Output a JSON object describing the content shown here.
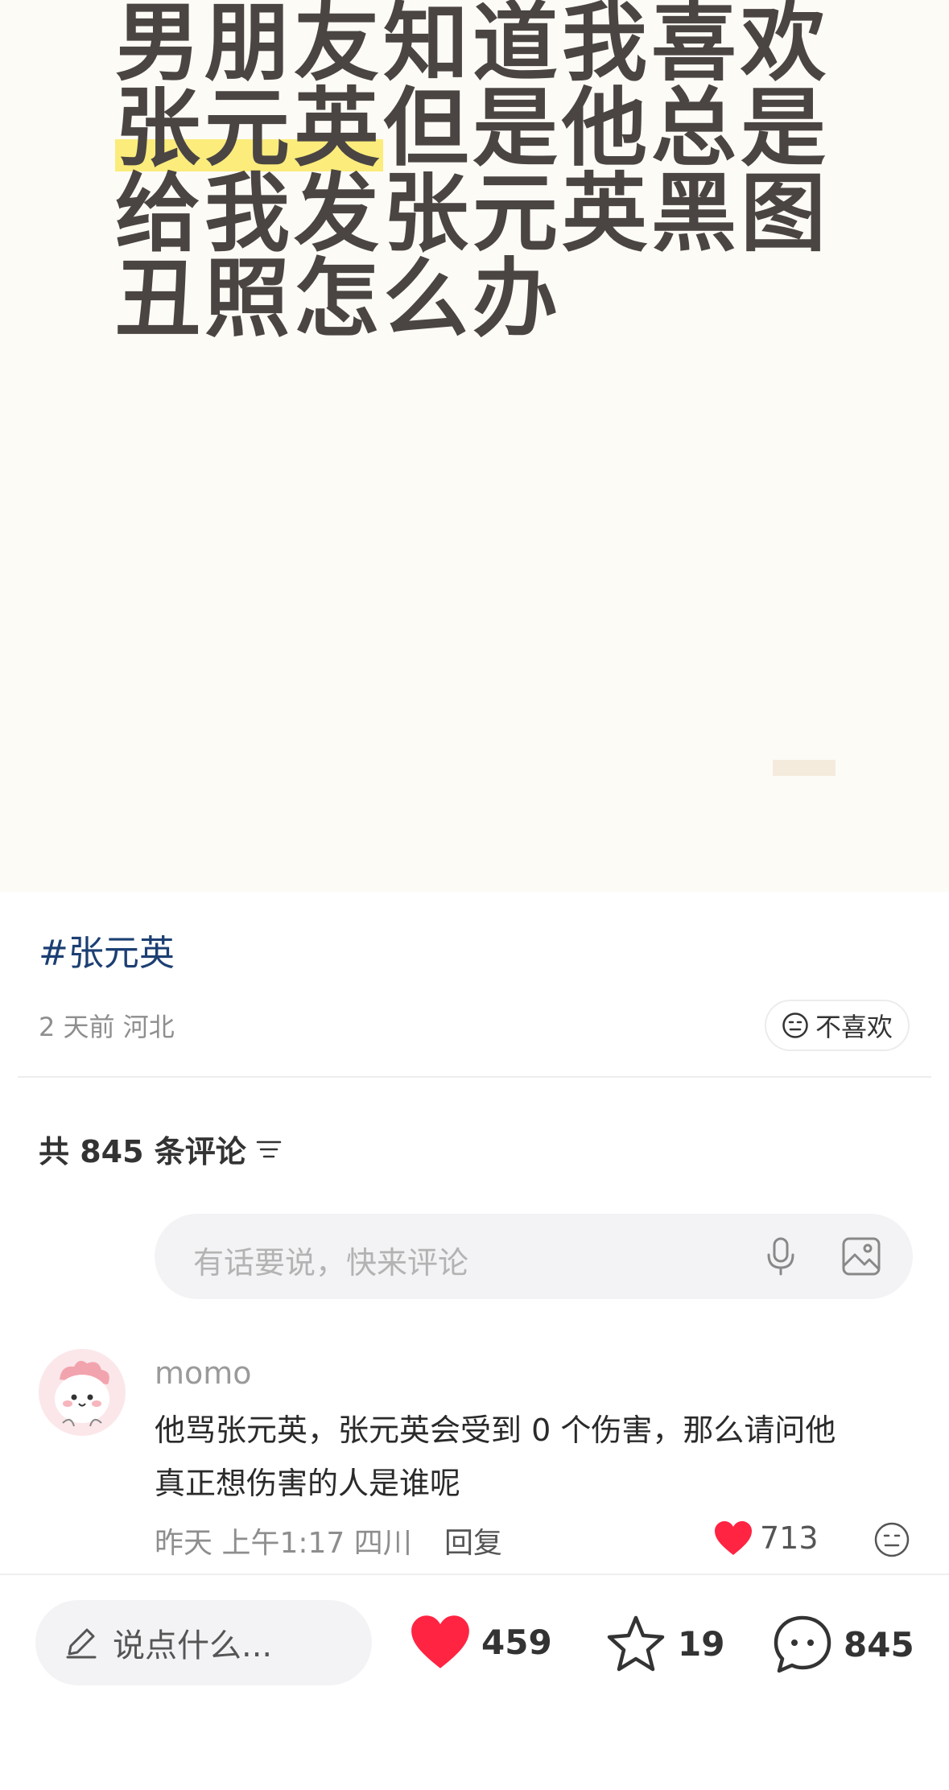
{
  "hero": {
    "lines": [
      "男朋友知道我喜欢",
      "张元英",
      "但是他总是",
      "给我发张元英黑图",
      "丑照怎么办"
    ]
  },
  "post": {
    "hashtag": "#张元英",
    "meta": "2 天前 河北",
    "dislike_label": "不喜欢"
  },
  "comments_section": {
    "count_label": "共 845 条评论",
    "input_placeholder": "有话要说，快来评论"
  },
  "comment": {
    "username": "momo",
    "text_line1": "他骂张元英，张元英会受到 0 个伤害，那么请问他",
    "text_line2": "真正想伤害的人是谁呢",
    "meta": "昨天 上午1:17 四川",
    "reply_label": "回复",
    "likes": "713"
  },
  "bottom_bar": {
    "input_placeholder": "说点什么...",
    "likes": "459",
    "stars": "19",
    "comments": "845"
  },
  "colors": {
    "hashtag": "#1c3f73",
    "like_red": "#ff2442",
    "highlight": "#fbec7c"
  },
  "icons": [
    "neutral-face-icon",
    "sort-icon",
    "microphone-icon",
    "image-icon",
    "heart-icon",
    "pencil-icon",
    "star-icon",
    "chat-bubble-icon"
  ]
}
